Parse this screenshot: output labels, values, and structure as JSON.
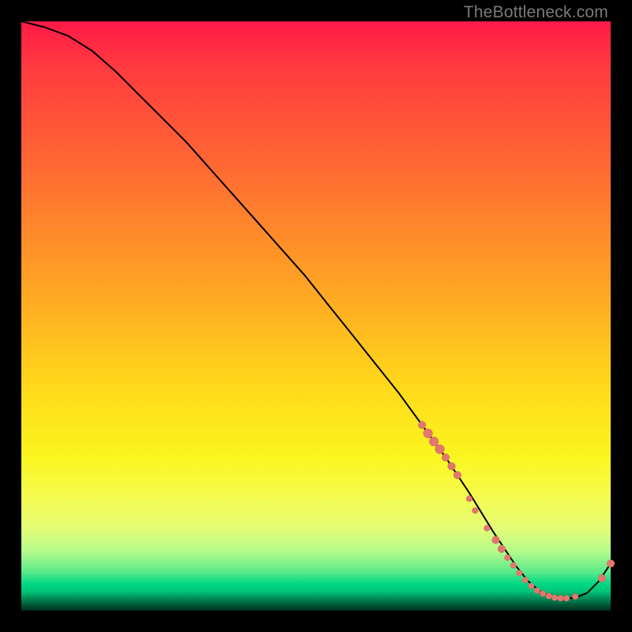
{
  "watermark": "TheBottleneck.com",
  "chart_data": {
    "type": "line",
    "title": "",
    "xlabel": "",
    "ylabel": "",
    "xlim": [
      0,
      100
    ],
    "ylim": [
      0,
      100
    ],
    "grid": false,
    "series": [
      {
        "name": "bottleneck-curve",
        "x": [
          0,
          4,
          8,
          12,
          16,
          20,
          24,
          28,
          32,
          36,
          40,
          44,
          48,
          52,
          56,
          60,
          64,
          68,
          72,
          76,
          80,
          82,
          84,
          86,
          88,
          90,
          92,
          94,
          96,
          98,
          100
        ],
        "y": [
          100,
          99,
          97.5,
          95,
          91.5,
          87.5,
          83.5,
          79.5,
          75,
          70.5,
          66,
          61.5,
          57,
          52,
          47,
          42,
          37,
          31.5,
          26,
          20,
          13.5,
          10.5,
          7.5,
          5,
          3.3,
          2.3,
          2,
          2.2,
          3,
          5,
          8
        ]
      }
    ],
    "markers": {
      "name": "highlighted-points",
      "color": "#e2786d",
      "points": [
        {
          "x": 68,
          "y": 31.5,
          "r": 5
        },
        {
          "x": 69,
          "y": 30.1,
          "r": 6
        },
        {
          "x": 70,
          "y": 28.7,
          "r": 6
        },
        {
          "x": 71,
          "y": 27.4,
          "r": 6
        },
        {
          "x": 72,
          "y": 26.0,
          "r": 5
        },
        {
          "x": 73,
          "y": 24.5,
          "r": 5
        },
        {
          "x": 74,
          "y": 23.0,
          "r": 5
        },
        {
          "x": 76,
          "y": 19.0,
          "r": 4
        },
        {
          "x": 77,
          "y": 17.0,
          "r": 4
        },
        {
          "x": 79,
          "y": 14.0,
          "r": 4
        },
        {
          "x": 80.5,
          "y": 12.0,
          "r": 5
        },
        {
          "x": 81.5,
          "y": 10.5,
          "r": 5
        },
        {
          "x": 82.5,
          "y": 9.0,
          "r": 4
        },
        {
          "x": 83.5,
          "y": 7.7,
          "r": 4
        },
        {
          "x": 84.5,
          "y": 6.4,
          "r": 4
        },
        {
          "x": 85.5,
          "y": 5.2,
          "r": 4
        },
        {
          "x": 86.5,
          "y": 4.2,
          "r": 4
        },
        {
          "x": 87.5,
          "y": 3.4,
          "r": 4
        },
        {
          "x": 88.5,
          "y": 2.9,
          "r": 4
        },
        {
          "x": 89.5,
          "y": 2.5,
          "r": 4
        },
        {
          "x": 90.5,
          "y": 2.2,
          "r": 4
        },
        {
          "x": 91.5,
          "y": 2.1,
          "r": 4
        },
        {
          "x": 92.5,
          "y": 2.1,
          "r": 4
        },
        {
          "x": 94.0,
          "y": 2.4,
          "r": 4
        },
        {
          "x": 98.5,
          "y": 5.5,
          "r": 5
        },
        {
          "x": 100.0,
          "y": 8.0,
          "r": 5
        }
      ]
    }
  }
}
